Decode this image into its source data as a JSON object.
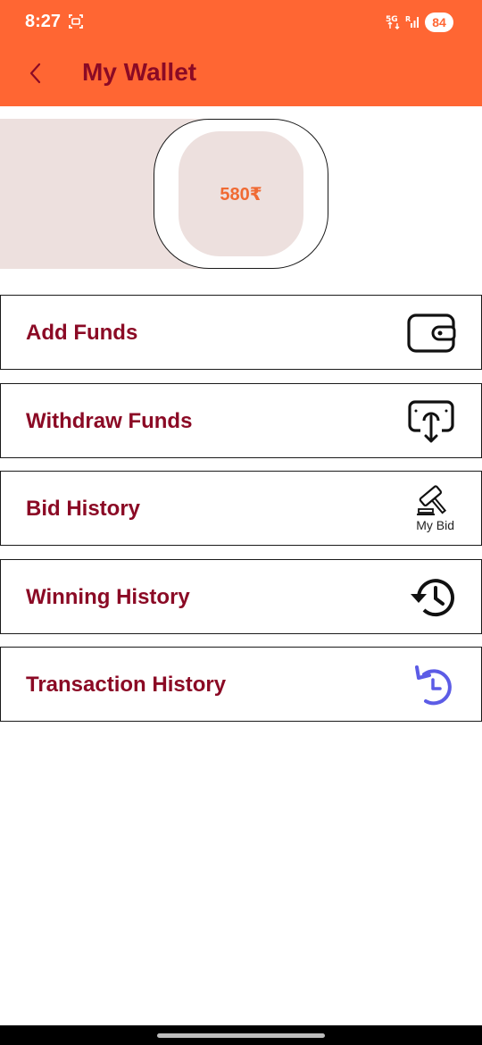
{
  "status_bar": {
    "time": "8:27",
    "network": "5G",
    "battery": "84"
  },
  "header": {
    "title": "My Wallet"
  },
  "wallet": {
    "balance": "580₹"
  },
  "menu": [
    {
      "label": "Add Funds",
      "icon": "wallet-icon"
    },
    {
      "label": "Withdraw Funds",
      "icon": "withdraw-icon"
    },
    {
      "label": "Bid History",
      "icon": "gavel-icon",
      "caption": "My Bid"
    },
    {
      "label": "Winning History",
      "icon": "history-icon"
    },
    {
      "label": "Transaction History",
      "icon": "undo-clock-icon"
    }
  ],
  "colors": {
    "header_bg": "#FF6633",
    "title_text": "#8B0A25",
    "balance_text": "#F06A33",
    "balance_bg": "#EDE0DE",
    "transaction_icon": "#5C5CE6"
  }
}
